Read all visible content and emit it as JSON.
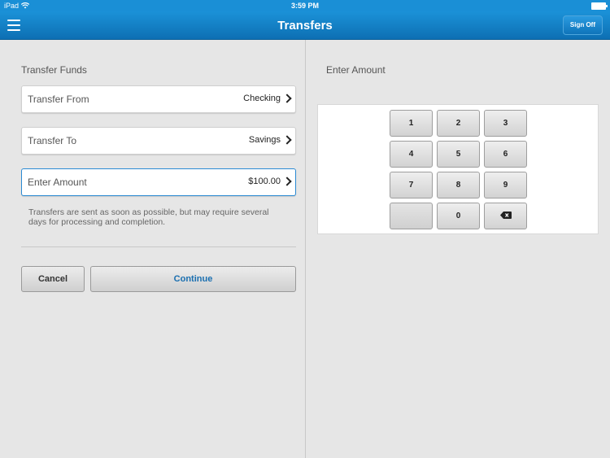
{
  "status_bar": {
    "device": "iPad",
    "time": "3:59 PM"
  },
  "nav": {
    "title": "Transfers",
    "sign_off": "Sign Off"
  },
  "left": {
    "section_title": "Transfer Funds",
    "transfer_from": {
      "label": "Transfer From",
      "value": "Checking"
    },
    "transfer_to": {
      "label": "Transfer To",
      "value": "Savings"
    },
    "amount": {
      "label": "Enter Amount",
      "value": "$100.00"
    },
    "disclaimer": "Transfers are sent as soon as possible, but may require several days for processing and completion.",
    "cancel": "Cancel",
    "continue": "Continue"
  },
  "right": {
    "section_title": "Enter Amount",
    "keys": [
      "1",
      "2",
      "3",
      "4",
      "5",
      "6",
      "7",
      "8",
      "9",
      "",
      "0"
    ]
  },
  "colors": {
    "brand_blue": "#0d6fb3",
    "continue_text": "#1a6fb0"
  }
}
